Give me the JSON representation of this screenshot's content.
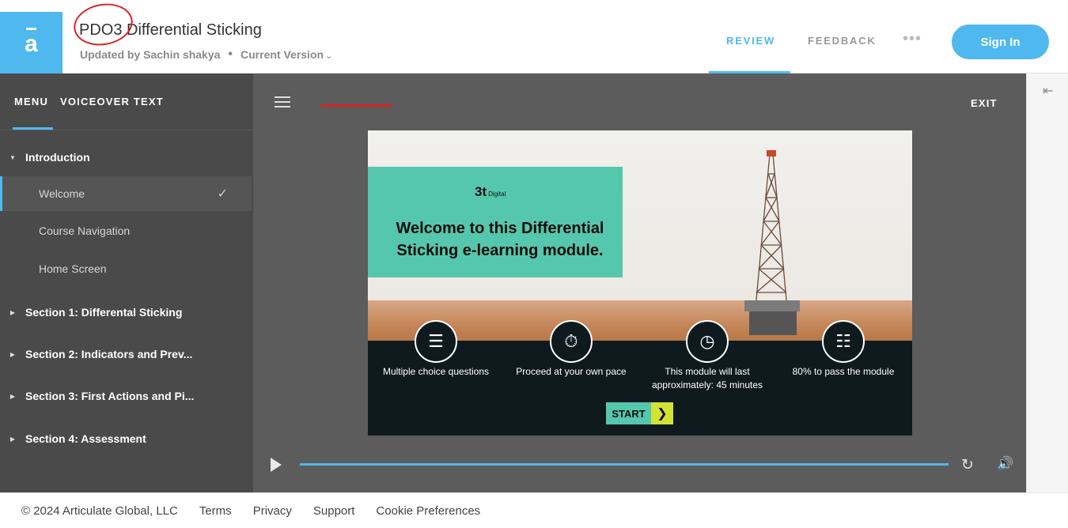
{
  "header": {
    "logo_glyph": "a",
    "course_title": "PDO3 Differential Sticking",
    "updated_by": "Updated by Sachin shakya",
    "separator": "•",
    "version": "Current Version",
    "tabs": {
      "review": "REVIEW",
      "feedback": "FEEDBACK"
    },
    "more": "•••",
    "signin": "Sign In"
  },
  "sidebar": {
    "tabs": {
      "menu": "MENU",
      "voiceover": "VOICEOVER TEXT"
    },
    "items": [
      {
        "label": "Introduction",
        "type": "section",
        "expanded": true
      },
      {
        "label": "Welcome",
        "type": "child",
        "active": true,
        "completed": true
      },
      {
        "label": "Course Navigation",
        "type": "child"
      },
      {
        "label": "Home Screen",
        "type": "child"
      },
      {
        "label": "Section 1: Differental Sticking",
        "type": "section"
      },
      {
        "label": "Section 2: Indicators and Prev...",
        "type": "section"
      },
      {
        "label": "Section 3: First Actions and Pi...",
        "type": "section"
      },
      {
        "label": "Section 4: Assessment",
        "type": "section"
      }
    ]
  },
  "player": {
    "exit": "EXIT",
    "slide": {
      "brand": "3t",
      "brand_sub": "Digital",
      "heading": "Welcome to this Differential Sticking e-learning module.",
      "features": [
        {
          "icon": "checklist-icon",
          "label": "Multiple choice questions"
        },
        {
          "icon": "stopwatch-icon",
          "label": "Proceed at your own pace"
        },
        {
          "icon": "clock-icon",
          "label": "This module will last approximately: 45 minutes"
        },
        {
          "icon": "certificate-icon",
          "label": "80% to pass the module"
        }
      ],
      "start": "START"
    }
  },
  "colors": {
    "accent": "#4fb8ee",
    "sidebar_bg": "#4a4a4a",
    "player_bg": "#5c5c5c",
    "slide_green": "#55c7ad",
    "slide_yellow": "#d3e334",
    "annotation_red": "#d92424"
  },
  "footer": {
    "copyright": "© 2024 Articulate Global, LLC",
    "links": [
      "Terms",
      "Privacy",
      "Support",
      "Cookie Preferences"
    ]
  }
}
